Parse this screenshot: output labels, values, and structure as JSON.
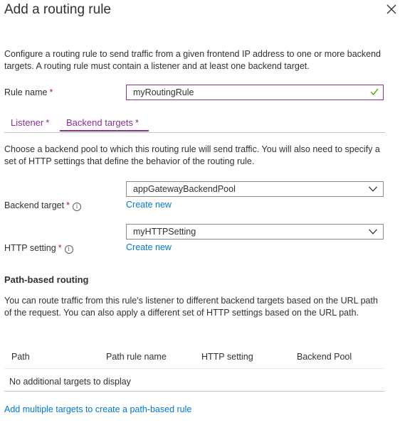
{
  "panel": {
    "title": "Add a routing rule",
    "description": "Configure a routing rule to send traffic from a given frontend IP address to one or more backend targets. A routing rule must contain a listener and at least one backend target."
  },
  "rule_name": {
    "label": "Rule name",
    "required_mark": "*",
    "value": "myRoutingRule"
  },
  "tabs": [
    {
      "label": "Listener",
      "required_mark": "*"
    },
    {
      "label": "Backend targets",
      "required_mark": "*",
      "selected": true
    }
  ],
  "backend_description": "Choose a backend pool to which this routing rule will send traffic. You will also need to specify a set of HTTP settings that define the behavior of the routing rule.",
  "backend_target": {
    "label": "Backend target",
    "required_mark": "*",
    "info_icon": "info-icon",
    "value": "appGatewayBackendPool",
    "create_new": "Create new"
  },
  "http_setting": {
    "label": "HTTP setting",
    "required_mark": "*",
    "info_icon": "info-icon",
    "value": "myHTTPSetting",
    "create_new": "Create new"
  },
  "path_based_routing": {
    "heading": "Path-based routing",
    "description": "You can route traffic from this rule's listener to different backend targets based on the URL path of the request. You can also apply a different set of HTTP settings based on the URL path.",
    "columns": [
      "Path",
      "Path rule name",
      "HTTP setting",
      "Backend Pool"
    ],
    "empty_text": "No additional targets to display",
    "add_link": "Add multiple targets to create a path-based rule"
  },
  "colors": {
    "accent": "#8c2f96",
    "link": "#0078d4",
    "required": "#a4262c",
    "valid_check": "#57a300"
  }
}
